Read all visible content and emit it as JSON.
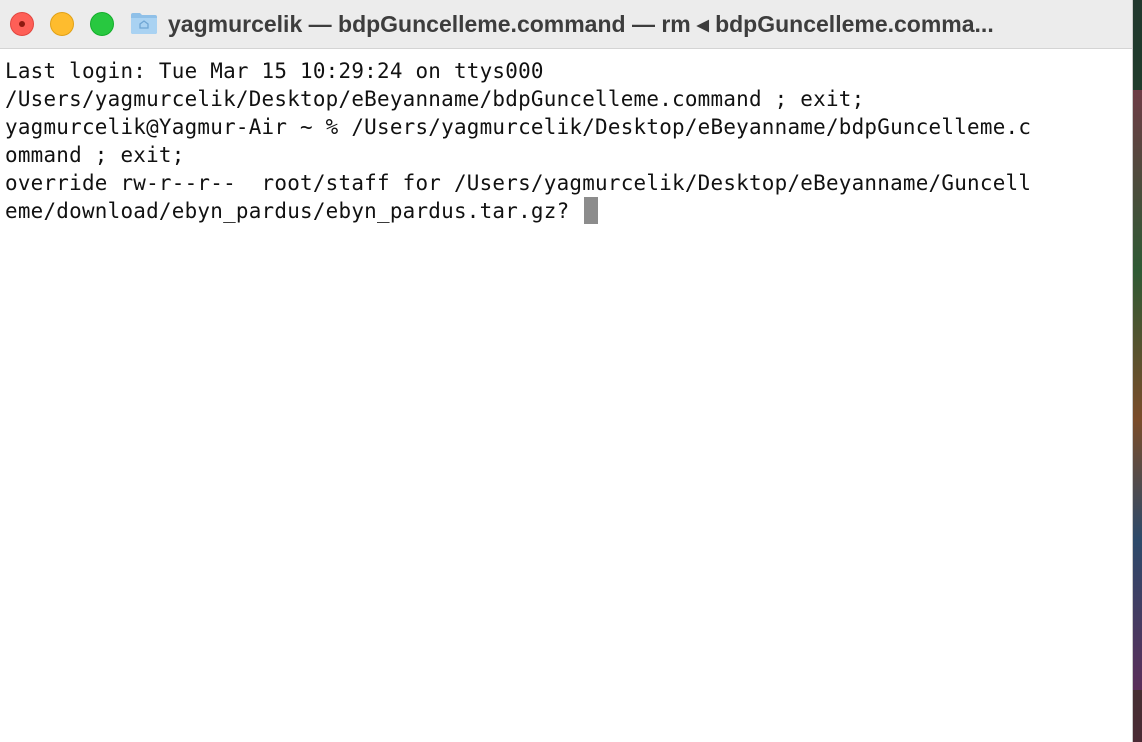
{
  "window": {
    "title": "yagmurcelik — bdpGuncelleme.command — rm ◂ bdpGuncelleme.comma...",
    "folder_icon": "home-folder-icon"
  },
  "traffic_lights": {
    "close_color": "#fe5f57",
    "minimize_color": "#febc2e",
    "zoom_color": "#28c840"
  },
  "terminal": {
    "lines": [
      "Last login: Tue Mar 15 10:29:24 on ttys000",
      "/Users/yagmurcelik/Desktop/eBeyanname/bdpGuncelleme.command ; exit;",
      "yagmurcelik@Yagmur-Air ~ % /Users/yagmurcelik/Desktop/eBeyanname/bdpGuncelleme.c",
      "ommand ; exit;",
      "override rw-r--r--  root/staff for /Users/yagmurcelik/Desktop/eBeyanname/Guncell",
      "eme/download/ebyn_pardus/ebyn_pardus.tar.gz? "
    ],
    "cursor_color": "#8c8c8c"
  }
}
